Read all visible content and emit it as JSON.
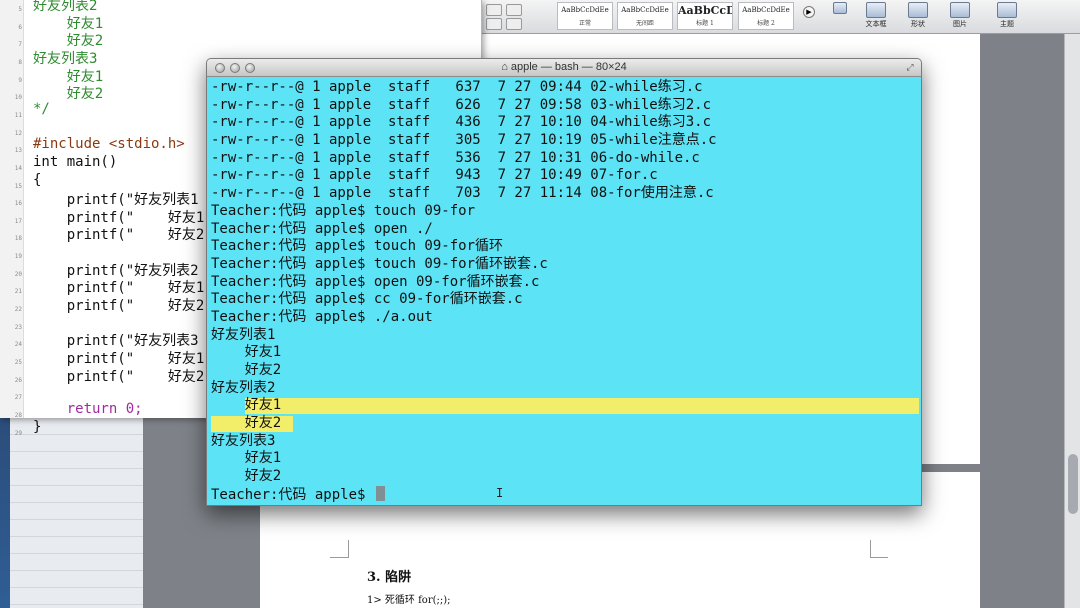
{
  "word": {
    "styles": [
      {
        "sample": "AaBbCcDdEe",
        "label": "正常"
      },
      {
        "sample": "AaBbCcDdEe",
        "label": "无间距"
      },
      {
        "sample": "AaBbCcD",
        "label": "标题 1"
      },
      {
        "sample": "AaBbCcDdEe",
        "label": "标题 2"
      }
    ],
    "tools": [
      {
        "label": "文本框"
      },
      {
        "label": "形状"
      },
      {
        "label": "图片"
      },
      {
        "label": "主题"
      }
    ],
    "scroll_glyph": "▶",
    "heading": "3.   陷阱",
    "item": "1>   死循环  for(;;);"
  },
  "editor": {
    "lines": [
      {
        "n": "5",
        "text": "好友列表2",
        "indent": "",
        "cls": "c-comment"
      },
      {
        "n": "6",
        "text": "好友1",
        "indent": "    ",
        "cls": "c-comment"
      },
      {
        "n": "7",
        "text": "好友2",
        "indent": "    ",
        "cls": "c-comment"
      },
      {
        "n": "8",
        "text": "好友列表3",
        "indent": "",
        "cls": "c-comment"
      },
      {
        "n": "9",
        "text": "好友1",
        "indent": "    ",
        "cls": "c-comment"
      },
      {
        "n": "10",
        "text": "好友2",
        "indent": "    ",
        "cls": "c-comment"
      },
      {
        "n": "11",
        "text": "*/",
        "indent": "",
        "cls": "c-comment"
      },
      {
        "n": "12",
        "text": "",
        "indent": "",
        "cls": ""
      },
      {
        "n": "13",
        "text": "#include <stdio.h>",
        "indent": "",
        "cls": "c-pre"
      },
      {
        "n": "14",
        "text": "int main()",
        "indent": "",
        "cls": ""
      },
      {
        "n": "15",
        "text": "{",
        "indent": "",
        "cls": ""
      },
      {
        "n": "16",
        "text": "printf(\"好友列表1",
        "indent": "    ",
        "cls": ""
      },
      {
        "n": "17",
        "text": "printf(\"    好友1",
        "indent": "    ",
        "cls": ""
      },
      {
        "n": "18",
        "text": "printf(\"    好友2",
        "indent": "    ",
        "cls": ""
      },
      {
        "n": "19",
        "text": "",
        "indent": "",
        "cls": ""
      },
      {
        "n": "20",
        "text": "printf(\"好友列表2",
        "indent": "    ",
        "cls": ""
      },
      {
        "n": "21",
        "text": "printf(\"    好友1",
        "indent": "    ",
        "cls": ""
      },
      {
        "n": "22",
        "text": "printf(\"    好友2",
        "indent": "    ",
        "cls": ""
      },
      {
        "n": "23",
        "text": "",
        "indent": "",
        "cls": ""
      },
      {
        "n": "24",
        "text": "printf(\"好友列表3",
        "indent": "    ",
        "cls": ""
      },
      {
        "n": "25",
        "text": "printf(\"    好友1",
        "indent": "    ",
        "cls": ""
      },
      {
        "n": "26",
        "text": "printf(\"    好友2",
        "indent": "    ",
        "cls": ""
      },
      {
        "n": "27",
        "text": "",
        "indent": "",
        "cls": ""
      },
      {
        "n": "28",
        "text": "return 0;",
        "indent": "    ",
        "cls": "c-kw"
      },
      {
        "n": "29",
        "text": "}",
        "indent": "",
        "cls": ""
      }
    ]
  },
  "terminal": {
    "title": "apple — bash — 80×24",
    "lines": [
      "-rw-r--r--@ 1 apple  staff   637  7 27 09:44 02-while练习.c",
      "-rw-r--r--@ 1 apple  staff   626  7 27 09:58 03-while练习2.c",
      "-rw-r--r--@ 1 apple  staff   436  7 27 10:10 04-while练习3.c",
      "-rw-r--r--@ 1 apple  staff   305  7 27 10:19 05-while注意点.c",
      "-rw-r--r--@ 1 apple  staff   536  7 27 10:31 06-do-while.c",
      "-rw-r--r--@ 1 apple  staff   943  7 27 10:49 07-for.c",
      "-rw-r--r--@ 1 apple  staff   703  7 27 11:14 08-for使用注意.c",
      "Teacher:代码 apple$ touch 09-for",
      "Teacher:代码 apple$ open ./",
      "Teacher:代码 apple$ touch 09-for循环",
      "Teacher:代码 apple$ touch 09-for循环嵌套.c",
      "Teacher:代码 apple$ open 09-for循环嵌套.c",
      "Teacher:代码 apple$ cc 09-for循环嵌套.c",
      "Teacher:代码 apple$ ./a.out",
      "好友列表1",
      "    好友1",
      "    好友2",
      "好友列表2",
      "    好友1",
      "    好友2",
      "好友列表3",
      "    好友1",
      "    好友2",
      "Teacher:代码 apple$ "
    ],
    "highlight_full_line": 18,
    "highlight_short_line": 19,
    "colors": {
      "background": "#5ce3f5",
      "highlight": "#f3ee6a"
    }
  }
}
